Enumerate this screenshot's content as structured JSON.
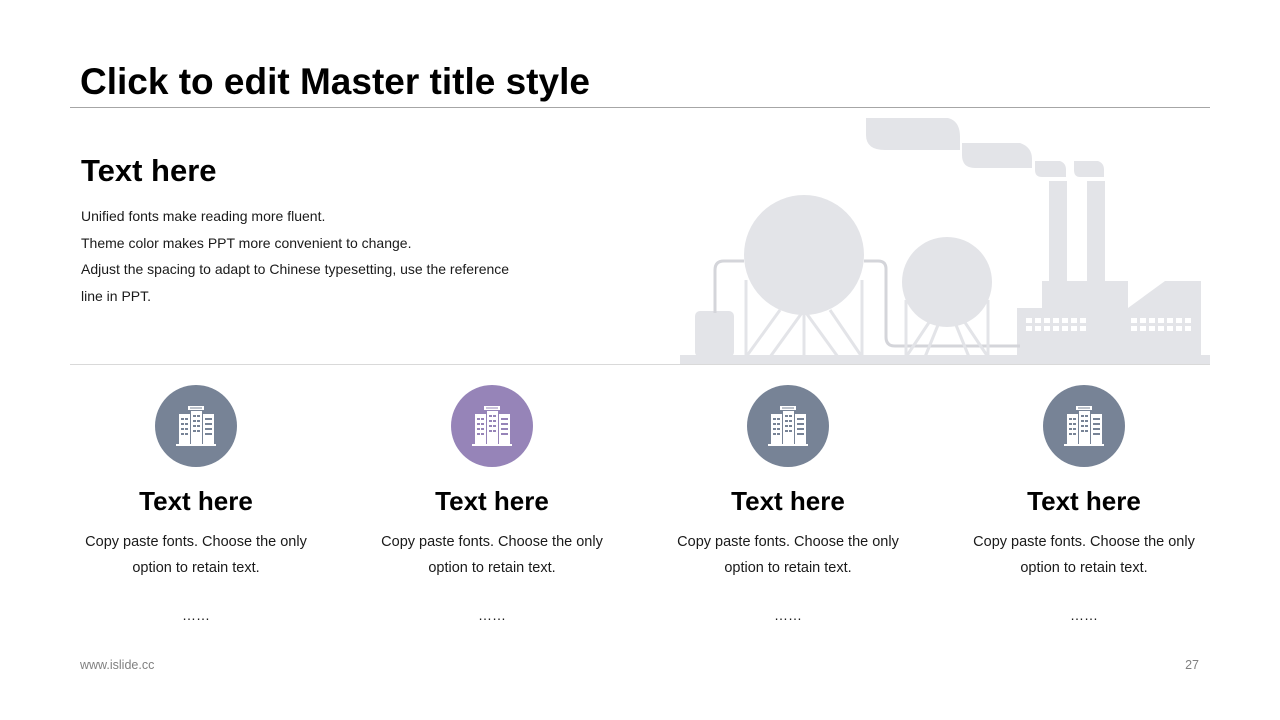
{
  "slide": {
    "title": "Click to edit Master title style",
    "page_number": "27",
    "footer_url": "www.islide.cc"
  },
  "intro": {
    "heading": "Text here",
    "lines": [
      "Unified fonts make reading more fluent.",
      "Theme color makes PPT more convenient to change.",
      "Adjust the spacing to adapt to Chinese typesetting, use the reference",
      "line in PPT."
    ]
  },
  "illustration": {
    "name": "factory-skyline",
    "color": "#e3e4e8"
  },
  "cards": [
    {
      "icon": "office-building-icon",
      "icon_color": "#778396",
      "title": "Text here",
      "line1": "Copy paste fonts. Choose the only",
      "line2": "option to retain text.",
      "ellipsis": "……"
    },
    {
      "icon": "office-building-icon",
      "icon_color": "#9684b8",
      "title": "Text here",
      "line1": "Copy paste fonts. Choose the only",
      "line2": "option to retain text.",
      "ellipsis": "……"
    },
    {
      "icon": "office-building-icon",
      "icon_color": "#778396",
      "title": "Text here",
      "line1": "Copy paste fonts. Choose the only",
      "line2": "option to retain text.",
      "ellipsis": "……"
    },
    {
      "icon": "office-building-icon",
      "icon_color": "#778396",
      "title": "Text here",
      "line1": "Copy paste fonts. Choose the only",
      "line2": "option to retain text.",
      "ellipsis": "……"
    }
  ]
}
